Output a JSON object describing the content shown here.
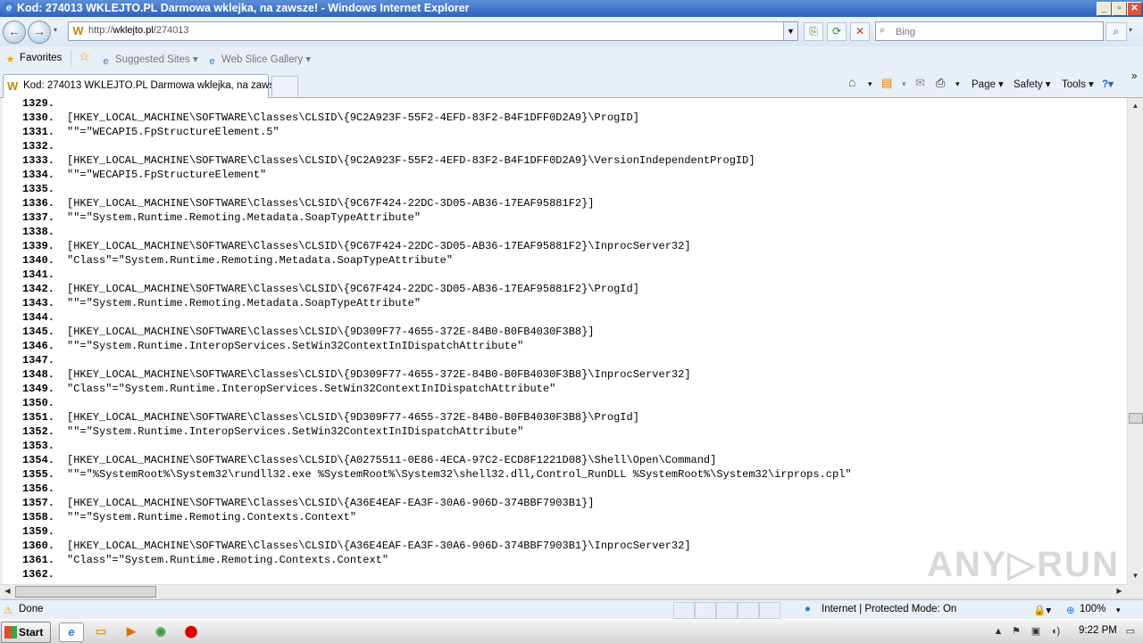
{
  "window": {
    "title": "Kod: 274013 WKLEJTO.PL Darmowa wklejka, na zawsze! - Windows Internet Explorer",
    "controls": [
      "_",
      "▫",
      "✕"
    ]
  },
  "address_bar": {
    "url_prefix": "http://",
    "url_host": "wklejto.pl",
    "url_path": "/274013"
  },
  "search": {
    "placeholder": "Bing"
  },
  "favorites_bar": {
    "favorites_label": "Favorites",
    "suggested_sites_label": "Suggested Sites ▾",
    "web_slice_label": "Web Slice Gallery ▾"
  },
  "tab": {
    "title": "Kod: 274013 WKLEJTO.PL Darmowa wklejka, na zaws..."
  },
  "command_bar": {
    "page_label": "Page ▾",
    "safety_label": "Safety ▾",
    "tools_label": "Tools ▾",
    "overflow_label": "»"
  },
  "code_lines": [
    {
      "num": "1329.",
      "text": ""
    },
    {
      "num": "1330.",
      "text": "[HKEY_LOCAL_MACHINE\\SOFTWARE\\Classes\\CLSID\\{9C2A923F-55F2-4EFD-83F2-B4F1DFF0D2A9}\\ProgID]"
    },
    {
      "num": "1331.",
      "text": "\"\"=\"WECAPI5.FpStructureElement.5\""
    },
    {
      "num": "1332.",
      "text": ""
    },
    {
      "num": "1333.",
      "text": "[HKEY_LOCAL_MACHINE\\SOFTWARE\\Classes\\CLSID\\{9C2A923F-55F2-4EFD-83F2-B4F1DFF0D2A9}\\VersionIndependentProgID]"
    },
    {
      "num": "1334.",
      "text": "\"\"=\"WECAPI5.FpStructureElement\""
    },
    {
      "num": "1335.",
      "text": ""
    },
    {
      "num": "1336.",
      "text": "[HKEY_LOCAL_MACHINE\\SOFTWARE\\Classes\\CLSID\\{9C67F424-22DC-3D05-AB36-17EAF95881F2}]"
    },
    {
      "num": "1337.",
      "text": "\"\"=\"System.Runtime.Remoting.Metadata.SoapTypeAttribute\""
    },
    {
      "num": "1338.",
      "text": ""
    },
    {
      "num": "1339.",
      "text": "[HKEY_LOCAL_MACHINE\\SOFTWARE\\Classes\\CLSID\\{9C67F424-22DC-3D05-AB36-17EAF95881F2}\\InprocServer32]"
    },
    {
      "num": "1340.",
      "text": "\"Class\"=\"System.Runtime.Remoting.Metadata.SoapTypeAttribute\""
    },
    {
      "num": "1341.",
      "text": ""
    },
    {
      "num": "1342.",
      "text": "[HKEY_LOCAL_MACHINE\\SOFTWARE\\Classes\\CLSID\\{9C67F424-22DC-3D05-AB36-17EAF95881F2}\\ProgId]"
    },
    {
      "num": "1343.",
      "text": "\"\"=\"System.Runtime.Remoting.Metadata.SoapTypeAttribute\""
    },
    {
      "num": "1344.",
      "text": ""
    },
    {
      "num": "1345.",
      "text": "[HKEY_LOCAL_MACHINE\\SOFTWARE\\Classes\\CLSID\\{9D309F77-4655-372E-84B0-B0FB4030F3B8}]"
    },
    {
      "num": "1346.",
      "text": "\"\"=\"System.Runtime.InteropServices.SetWin32ContextInIDispatchAttribute\""
    },
    {
      "num": "1347.",
      "text": ""
    },
    {
      "num": "1348.",
      "text": "[HKEY_LOCAL_MACHINE\\SOFTWARE\\Classes\\CLSID\\{9D309F77-4655-372E-84B0-B0FB4030F3B8}\\InprocServer32]"
    },
    {
      "num": "1349.",
      "text": "\"Class\"=\"System.Runtime.InteropServices.SetWin32ContextInIDispatchAttribute\""
    },
    {
      "num": "1350.",
      "text": ""
    },
    {
      "num": "1351.",
      "text": "[HKEY_LOCAL_MACHINE\\SOFTWARE\\Classes\\CLSID\\{9D309F77-4655-372E-84B0-B0FB4030F3B8}\\ProgId]"
    },
    {
      "num": "1352.",
      "text": "\"\"=\"System.Runtime.InteropServices.SetWin32ContextInIDispatchAttribute\""
    },
    {
      "num": "1353.",
      "text": ""
    },
    {
      "num": "1354.",
      "text": "[HKEY_LOCAL_MACHINE\\SOFTWARE\\Classes\\CLSID\\{A0275511-0E86-4ECA-97C2-ECD8F1221D08}\\Shell\\Open\\Command]"
    },
    {
      "num": "1355.",
      "text": "\"\"=\"%SystemRoot%\\System32\\rundll32.exe %SystemRoot%\\System32\\shell32.dll,Control_RunDLL %SystemRoot%\\System32\\irprops.cpl\""
    },
    {
      "num": "1356.",
      "text": ""
    },
    {
      "num": "1357.",
      "text": "[HKEY_LOCAL_MACHINE\\SOFTWARE\\Classes\\CLSID\\{A36E4EAF-EA3F-30A6-906D-374BBF7903B1}]"
    },
    {
      "num": "1358.",
      "text": "\"\"=\"System.Runtime.Remoting.Contexts.Context\""
    },
    {
      "num": "1359.",
      "text": ""
    },
    {
      "num": "1360.",
      "text": "[HKEY_LOCAL_MACHINE\\SOFTWARE\\Classes\\CLSID\\{A36E4EAF-EA3F-30A6-906D-374BBF7903B1}\\InprocServer32]"
    },
    {
      "num": "1361.",
      "text": "\"Class\"=\"System.Runtime.Remoting.Contexts.Context\""
    },
    {
      "num": "1362.",
      "text": ""
    }
  ],
  "status_bar": {
    "status_text": "Done",
    "zone_text": "Internet | Protected Mode: On",
    "zoom_text": "100%"
  },
  "taskbar": {
    "start_label": "Start",
    "clock": "9:22 PM"
  },
  "watermark": "ANY▷RUN",
  "colors": {
    "titlebar": "#2d62c0",
    "chrome": "#e9eff7",
    "text": "#000000"
  }
}
